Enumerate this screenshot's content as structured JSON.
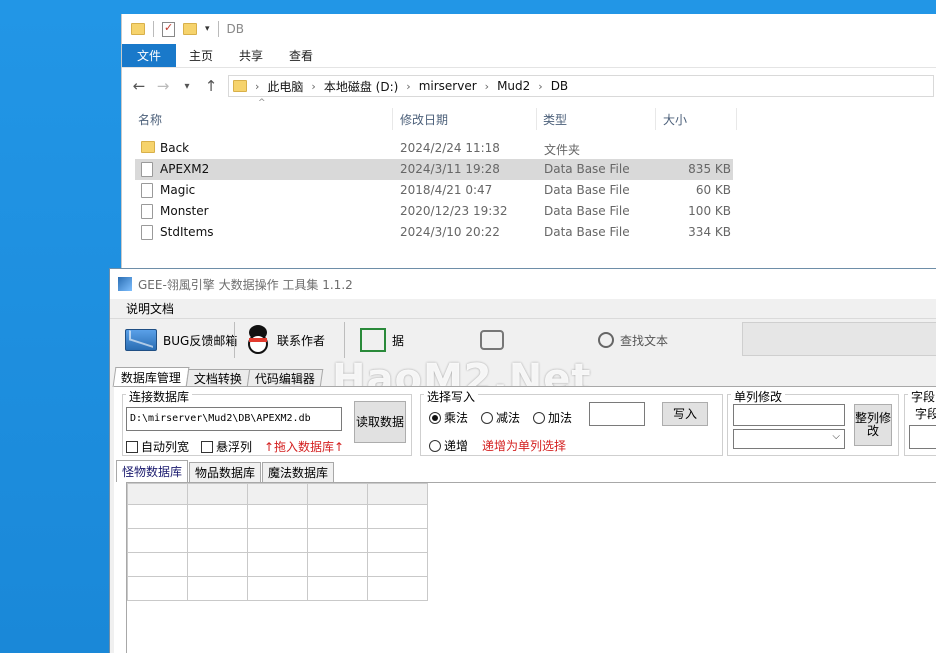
{
  "explorer": {
    "title": "DB",
    "ribbon_tabs": [
      "文件",
      "主页",
      "共享",
      "查看"
    ],
    "breadcrumb": [
      "此电脑",
      "本地磁盘 (D:)",
      "mirserver",
      "Mud2",
      "DB"
    ],
    "columns": {
      "name": "名称",
      "date": "修改日期",
      "type": "类型",
      "size": "大小"
    },
    "files": [
      {
        "name": "Back",
        "date": "2024/2/24 11:18",
        "type": "文件夹",
        "size": "",
        "icon": "folder-icon",
        "selected": false
      },
      {
        "name": "APEXM2",
        "date": "2024/3/11 19:28",
        "type": "Data Base File",
        "size": "835 KB",
        "icon": "file-icon",
        "selected": true
      },
      {
        "name": "Magic",
        "date": "2018/4/21 0:47",
        "type": "Data Base File",
        "size": "60 KB",
        "icon": "file-icon",
        "selected": false
      },
      {
        "name": "Monster",
        "date": "2020/12/23 19:32",
        "type": "Data Base File",
        "size": "100 KB",
        "icon": "file-icon",
        "selected": false
      },
      {
        "name": "StdItems",
        "date": "2024/3/10 20:22",
        "type": "Data Base File",
        "size": "334 KB",
        "icon": "file-icon",
        "selected": false
      }
    ]
  },
  "tool": {
    "title": "GEE-翎風引擎 大数据操作 工具集  1.1.2",
    "menu": [
      "说明文档"
    ],
    "toolbar": {
      "bug_label": "BUG反馈邮箱",
      "contact_label": "联系作者",
      "item3_label": "据",
      "search_label": "查找文本"
    },
    "watermark": "HaoM2.Net",
    "tabs": [
      "数据库管理",
      "文档转换",
      "代码编辑器"
    ],
    "connect": {
      "group_title": "连接数据库",
      "path": "D:\\mirserver\\Mud2\\DB\\APEXM2.db",
      "read_button": "读取数据",
      "auto_width": "自动列宽",
      "float_column": "悬浮列",
      "drag_hint": "↑拖入数据库↑"
    },
    "write": {
      "group_title": "选择写入",
      "options": [
        "乘法",
        "减法",
        "加法",
        "递增"
      ],
      "selected": "乘法",
      "increment_hint": "递增为单列选择",
      "write_button": "写入",
      "value": ""
    },
    "single": {
      "group_title": "单列修改",
      "whole_button": "整列修改"
    },
    "field": {
      "group_title": "字段",
      "label": "字段"
    },
    "db_tabs": [
      "怪物数据库",
      "物品数据库",
      "魔法数据库"
    ]
  },
  "colors": {
    "accent": "#1979ca",
    "desktop": "#1e8fe0",
    "hint_red": "#d42020"
  }
}
